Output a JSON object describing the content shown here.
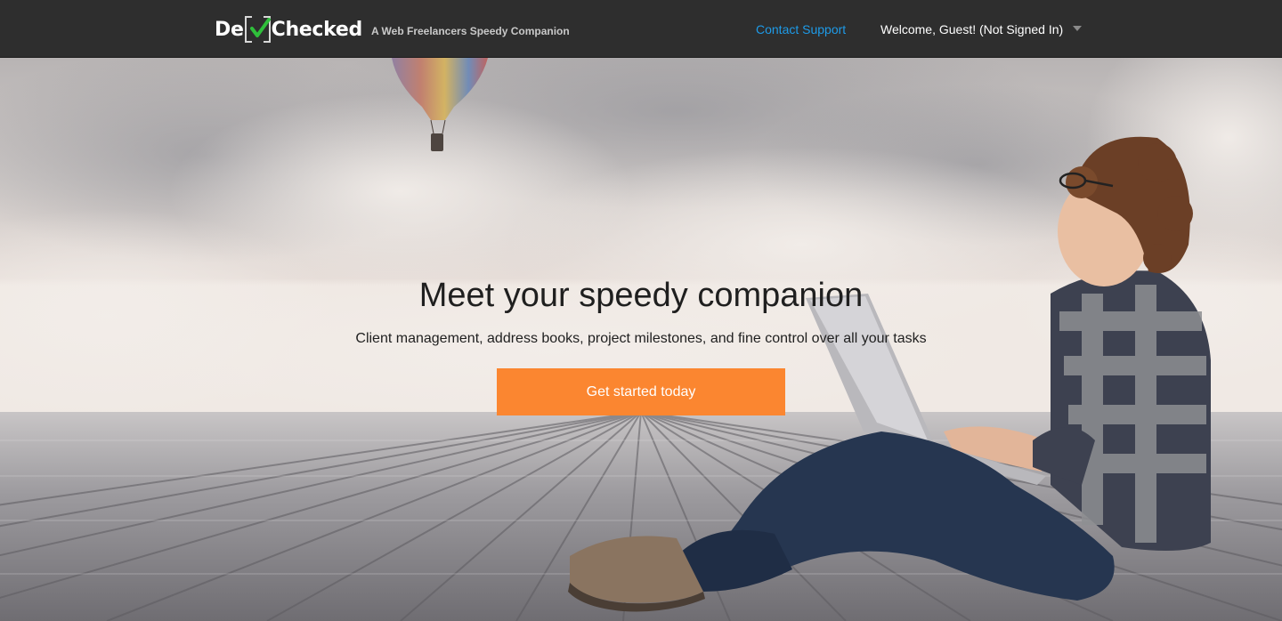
{
  "brand": {
    "logo_left": "De",
    "logo_right": "Checked",
    "tagline": "A Web Freelancers Speedy Companion"
  },
  "nav": {
    "contact_label": "Contact Support",
    "user_label": "Welcome, Guest! (Not Signed In)"
  },
  "hero": {
    "title": "Meet your speedy companion",
    "subtitle": "Client management, address books, project milestones, and fine control over all your tasks",
    "cta_label": "Get started today"
  },
  "colors": {
    "navbar": "#2e2e2e",
    "link": "#1e9be8",
    "cta": "#fb8630",
    "check": "#2fbf3b"
  },
  "icons": [
    "checkmark-icon",
    "caret-down-icon"
  ]
}
